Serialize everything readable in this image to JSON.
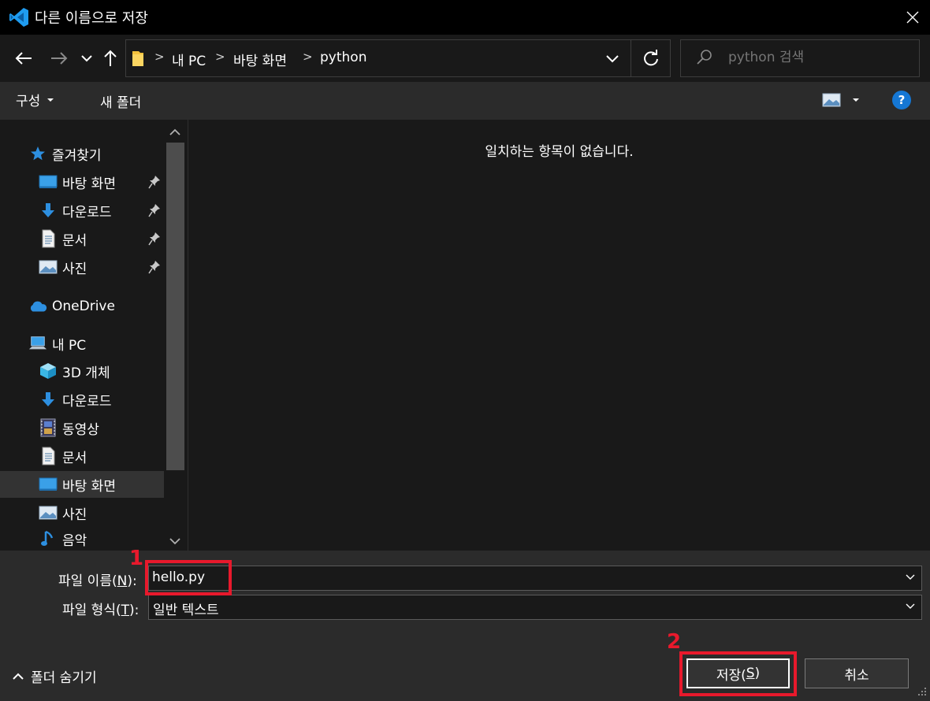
{
  "window": {
    "title": "다른 이름으로 저장",
    "app_icon": "vscode-icon",
    "close_icon": "close-icon"
  },
  "nav": {
    "back_icon": "arrow-left-icon",
    "forward_icon": "arrow-right-icon",
    "recent_icon": "chevron-down-icon",
    "up_icon": "arrow-up-icon",
    "breadcrumb": [
      "내 PC",
      "바탕 화면",
      "python"
    ],
    "breadcrumb_sep": ">",
    "refresh_icon": "refresh-icon",
    "search_placeholder": "python 검색"
  },
  "toolbar": {
    "organize_label": "구성",
    "new_folder_label": "새 폴더",
    "help_label": "?"
  },
  "sidebar": {
    "quick_access": {
      "label": "즐겨찾기",
      "items": [
        {
          "label": "바탕 화면",
          "icon": "desktop-icon",
          "pinned": true
        },
        {
          "label": "다운로드",
          "icon": "download-icon",
          "pinned": true
        },
        {
          "label": "문서",
          "icon": "document-icon",
          "pinned": true
        },
        {
          "label": "사진",
          "icon": "pictures-icon",
          "pinned": true
        }
      ]
    },
    "onedrive_label": "OneDrive",
    "this_pc": {
      "label": "내 PC",
      "items": [
        {
          "label": "3D 개체",
          "icon": "3d-objects-icon"
        },
        {
          "label": "다운로드",
          "icon": "download-icon"
        },
        {
          "label": "동영상",
          "icon": "video-icon"
        },
        {
          "label": "문서",
          "icon": "document-icon"
        },
        {
          "label": "바탕 화면",
          "icon": "desktop-icon",
          "selected": true
        },
        {
          "label": "사진",
          "icon": "pictures-icon"
        },
        {
          "label": "음악",
          "icon": "music-icon"
        }
      ]
    }
  },
  "content": {
    "empty_message": "일치하는 항목이 없습니다."
  },
  "form": {
    "filename_label_pre": "파일 이름(",
    "filename_label_key": "N",
    "filename_label_post": "):",
    "filename_value": "hello.py",
    "filetype_label_pre": "파일 형식(",
    "filetype_label_key": "T",
    "filetype_label_post": "):",
    "filetype_value": "일반 텍스트"
  },
  "footer": {
    "hide_folders_label": "폴더 숨기기",
    "save_label_pre": "저장(",
    "save_label_key": "S",
    "save_label_post": ")",
    "cancel_label": "취소"
  },
  "annotations": [
    {
      "number": "1",
      "target": "filename-input"
    },
    {
      "number": "2",
      "target": "save-button"
    }
  ],
  "colors": {
    "accent": "#1577d4",
    "annotation": "#e8192c",
    "background": "#191919",
    "panel": "#2b2b2b"
  }
}
